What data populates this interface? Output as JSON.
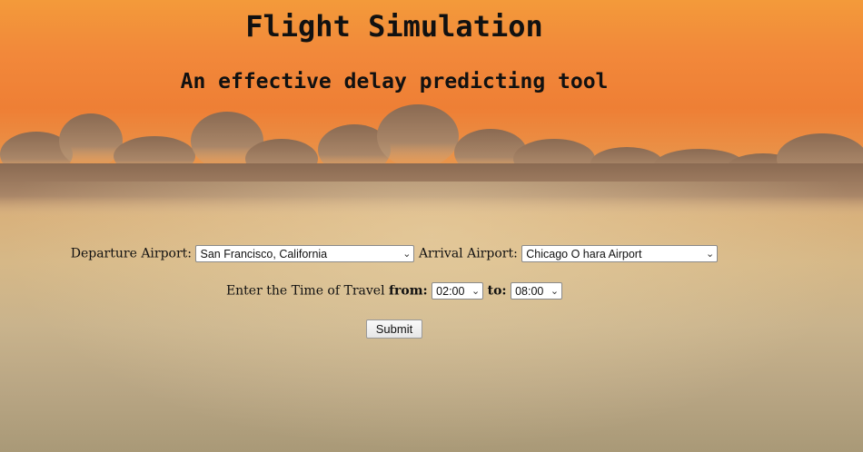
{
  "header": {
    "title": "Flight Simulation",
    "subtitle": "An effective delay predicting tool"
  },
  "form": {
    "departure_label": "Departure Airport:",
    "departure_value": "San Francisco, California",
    "arrival_label": "Arrival Airport:",
    "arrival_value": "Chicago O hara Airport",
    "time_label": "Enter the Time of Travel",
    "from_label": "from:",
    "from_value": "02:00",
    "to_label": "to:",
    "to_value": "08:00",
    "submit_label": "Submit"
  },
  "icons": {
    "dropdown": "chevron-down-icon"
  },
  "colors": {
    "sky_top": "#f39a3a",
    "sky_mid": "#ee7f35",
    "haze": "#d6b887",
    "text": "#111111"
  }
}
